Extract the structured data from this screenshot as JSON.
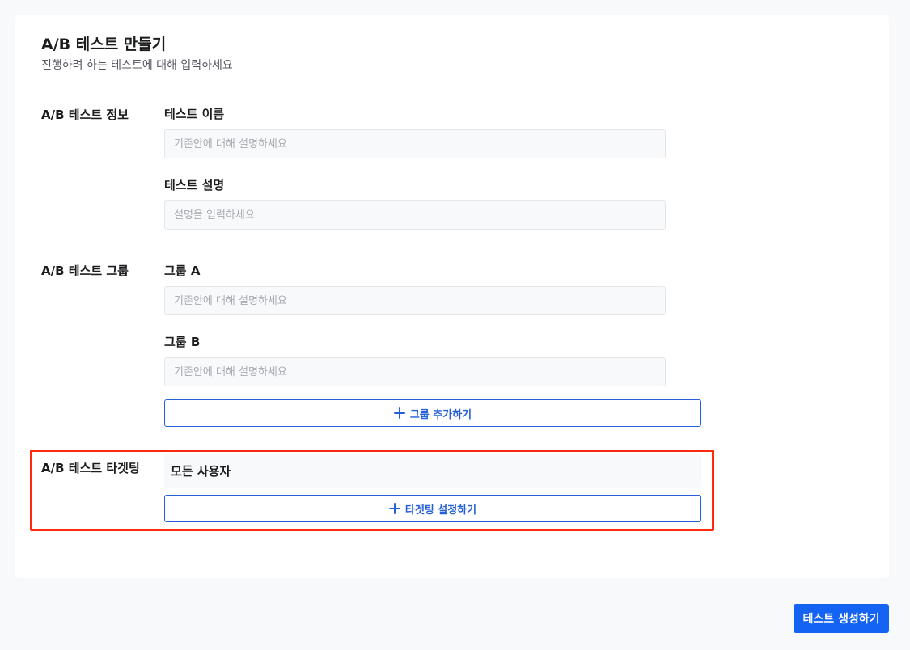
{
  "header": {
    "title": "A/B 테스트 만들기",
    "subtitle": "진행하려 하는 테스트에 대해 입력하세요"
  },
  "info_section": {
    "label": "A/B 테스트 정보",
    "name_label": "테스트 이름",
    "name_placeholder": "기존안에 대해 설명하세요",
    "desc_label": "테스트 설명",
    "desc_placeholder": "설명을 입력하세요"
  },
  "group_section": {
    "label": "A/B 테스트 그룹",
    "group_a_label": "그룹 A",
    "group_a_placeholder": "기존안에 대해 설명하세요",
    "group_b_label": "그룹 B",
    "group_b_placeholder": "기존안에 대해 설명하세요",
    "add_group_label": "그룹 추가하기"
  },
  "targeting_section": {
    "label": "A/B 테스트 타겟팅",
    "audience": "모든 사용자",
    "set_targeting_label": "타겟팅 설정하기"
  },
  "footer": {
    "create_label": "테스트 생성하기"
  },
  "colors": {
    "accent": "#2660d9",
    "primary": "#1463f3",
    "highlight": "#ff2a0d"
  }
}
